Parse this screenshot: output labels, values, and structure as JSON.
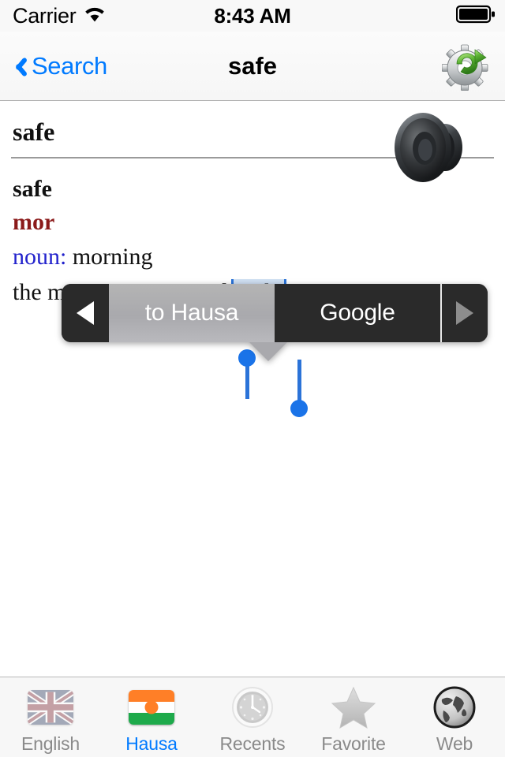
{
  "statusbar": {
    "carrier": "Carrier",
    "wifi_icon": "wifi-icon",
    "time": "8:43 AM",
    "battery_icon": "battery-full-icon"
  },
  "navbar": {
    "back_label": "Search",
    "back_icon": "chevron-left-icon",
    "title": "safe",
    "action_icon": "gear-refresh-icon"
  },
  "entry": {
    "headword": "safe",
    "speaker_icon": "speaker-icon",
    "lines": {
      "word": "safe",
      "translation": "mor",
      "pos_tag": "noun:",
      "pos_value": " morning",
      "synonyms_prefix": "the morning, am, good ",
      "selected_text": "night"
    }
  },
  "popup": {
    "prev_icon": "triangle-left-icon",
    "next_icon": "triangle-right-icon",
    "items": [
      {
        "label": "to Hausa",
        "active": true
      },
      {
        "label": "Google",
        "active": false
      }
    ]
  },
  "tabbar": {
    "tabs": [
      {
        "label": "English",
        "icon": "uk-flag-icon",
        "active": false
      },
      {
        "label": "Hausa",
        "icon": "niger-flag-icon",
        "active": true
      },
      {
        "label": "Recents",
        "icon": "clock-icon",
        "active": false
      },
      {
        "label": "Favorite",
        "icon": "star-icon",
        "active": false
      },
      {
        "label": "Web",
        "icon": "globe-icon",
        "active": false
      }
    ]
  },
  "colors": {
    "accent": "#007aff",
    "translation": "#8b1a1a",
    "pos": "#2222cc",
    "selection": "#cfdff2",
    "handle": "#1a73e8"
  }
}
